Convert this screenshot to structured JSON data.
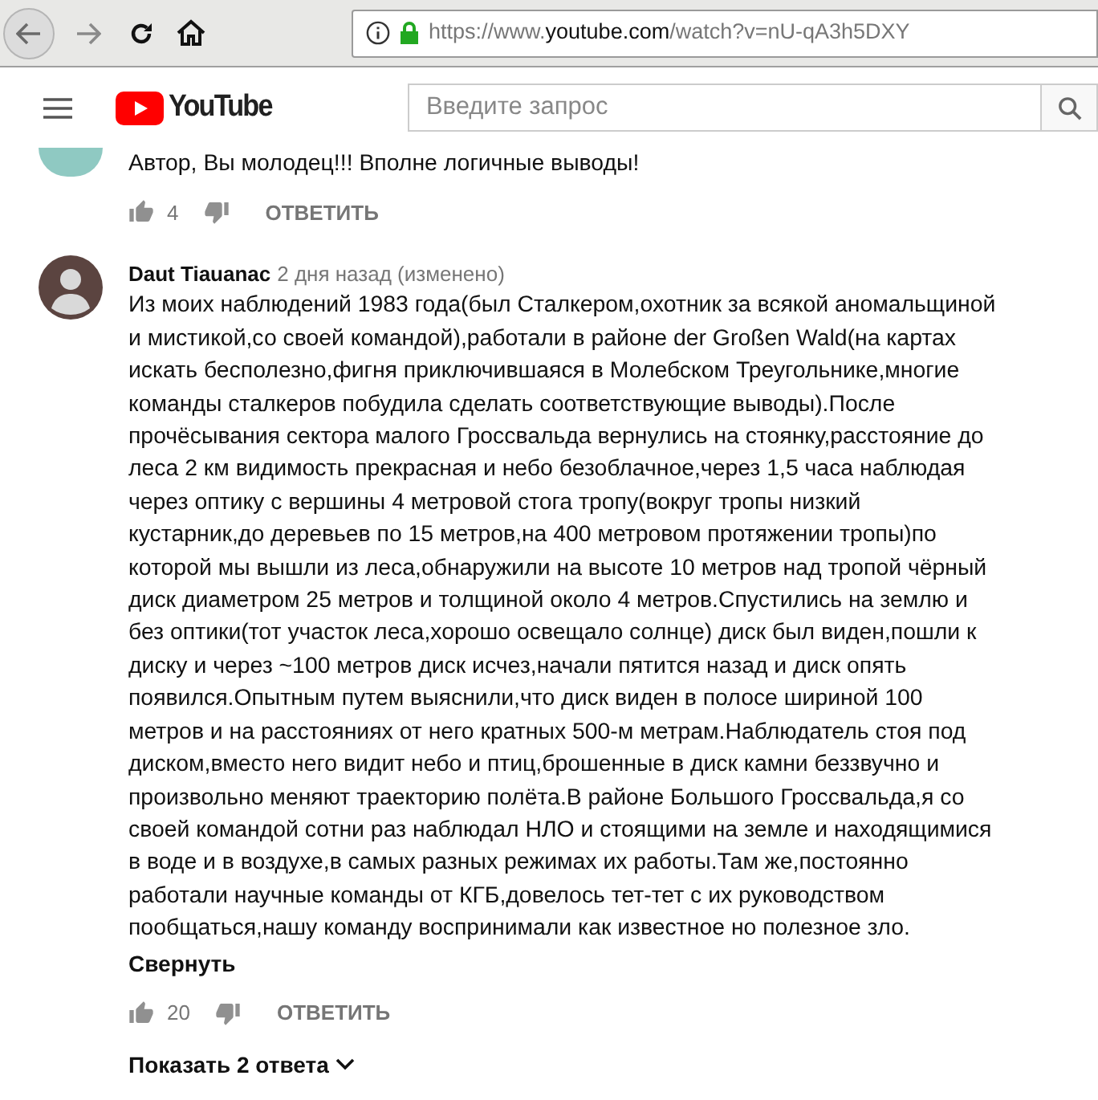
{
  "browser": {
    "url_prefix": "https://www.",
    "url_domain": "youtube.com",
    "url_path": "/watch?v=nU-qA3h5DXY"
  },
  "masthead": {
    "logo": "YouTube",
    "search": {
      "placeholder": "Введите запрос"
    }
  },
  "comments": [
    {
      "color": "#8fc9c2",
      "text_lines": [
        "Автор, Вы молодец!!! Вполне логичные выводы!"
      ],
      "likes": "4",
      "reply": "ОТВЕТИТЬ"
    },
    {
      "color": "#5b4440",
      "author": "Daut Tiauanac",
      "time": "2 дня назад (изменено)",
      "text_lines": [
        "Из моих наблюдений 1983 года(был Сталкером,охотник за всякой аномальщиной",
        "и мистикой,со своей командой),работали в районе der Großen Wald(на картах",
        "искать бесполезно,фигня приключившаяся в Молебском Треугольнике,многие",
        "команды сталкеров побудила сделать соответствующие выводы).После",
        "прочёсывания сектора малого Гроссвальда вернулись на стоянку,расстояние до",
        "леса 2 км видимость прекрасная и небо безоблачное,через 1,5 часа наблюдая",
        "через оптику с вершины 4 метровой стога тропу(вокруг тропы низкий",
        "кустарник,до деревьев по 15 метров,на 400 метровом протяжении тропы)по",
        "которой мы вышли из леса,обнаружили на высоте 10 метров над тропой чёрный",
        "диск диаметром 25 метров и толщиной около 4 метров.Спустились на землю и",
        "без оптики(тот участок леса,хорошо освещало солнце) диск был виден,пошли к",
        "диску и через ~100 метров диск исчез,начали пятится назад и диск опять",
        "появился.Опытным путем выяснили,что диск виден в полосе шириной 100",
        "метров и на расстояниях от него кратных 500-м метрам.Наблюдатель стоя под",
        "диском,вместо него видит небо и птиц,брошенные в диск камни беззвучно и",
        "произвольно меняют траекторию полёта.В районе Большого Гроссвальда,я со",
        "своей командой сотни раз наблюдал НЛО и стоящими на земле и находящимися",
        "в воде и в воздухе,в самых разных режимах их работы.Там же,постоянно",
        "работали научные команды от КГБ,довелось тет-тет с их руководством",
        "пообщаться,нашу команду воспринимали как известное но полезное зло."
      ],
      "collapse": "Свернуть",
      "likes": "20",
      "reply": "ОТВЕТИТЬ",
      "show_replies": "Показать 2 ответа"
    }
  ]
}
